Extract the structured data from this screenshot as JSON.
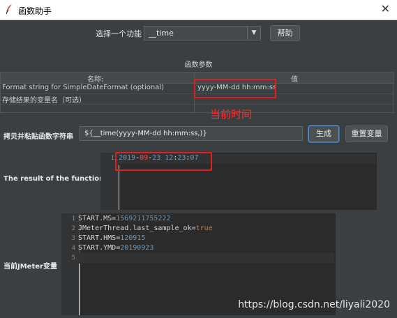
{
  "window": {
    "title": "函数助手",
    "close_glyph": "✕"
  },
  "function_select": {
    "label": "选择一个功能",
    "value": "__time",
    "arrow_glyph": "▼"
  },
  "help_button": "帮助",
  "params_section_title": "函数参数",
  "params_table": {
    "col_name": "名称:",
    "col_value": "值",
    "rows": [
      {
        "name": "Format string for SimpleDateFormat (optional)",
        "value": "yyyy-MM-dd hh:mm:ss"
      },
      {
        "name": "存储结果的变量名（可选）",
        "value": ""
      }
    ]
  },
  "annotation_current_time": "当前时间",
  "copy_row": {
    "label": "拷贝并粘贴函数字符串",
    "value": "${__time(yyyy-MM-dd hh:mm:ss,)}",
    "generate_button": "生成",
    "reset_button": "重置变量"
  },
  "result": {
    "label": "The result of the function is",
    "lines": [
      {
        "num": "1",
        "parts": [
          {
            "t": "2019",
            "c": "#6897bb"
          },
          {
            "t": "-",
            "c": "#cdd3de"
          },
          {
            "t": "09",
            "c": "#ff4444"
          },
          {
            "t": "-",
            "c": "#cdd3de"
          },
          {
            "t": "23 12",
            "c": "#6897bb"
          },
          {
            "t": ":",
            "c": "#cdd3de"
          },
          {
            "t": "23",
            "c": "#6897bb"
          },
          {
            "t": ":",
            "c": "#cdd3de"
          },
          {
            "t": "07",
            "c": "#6897bb"
          }
        ]
      }
    ]
  },
  "jmeter_vars": {
    "label": "当前JMeter变量",
    "lines": [
      {
        "num": "1",
        "key": "START.MS",
        "eq": "=",
        "val": "1569211755222",
        "val_color": "#6897bb"
      },
      {
        "num": "2",
        "key": "JMeterThread.last_sample_ok",
        "eq": "=",
        "val": "true",
        "val_color": "#cc7832"
      },
      {
        "num": "3",
        "key": "START.HMS",
        "eq": "=",
        "val": "120915",
        "val_color": "#6897bb"
      },
      {
        "num": "4",
        "key": "START.YMD",
        "eq": "=",
        "val": "20190923",
        "val_color": "#6897bb"
      },
      {
        "num": "5",
        "key": "",
        "eq": "",
        "val": "",
        "val_color": "#6897bb"
      }
    ]
  },
  "watermark": "https://blog.csdn.net/liyali2020",
  "colors": {
    "highlight": "#e02020",
    "annotation": "#ff2d2d",
    "background": "#3c3f41"
  },
  "icons": {
    "app_icon": "feather-icon",
    "close": "close-icon",
    "dropdown": "chevron-down-icon"
  }
}
